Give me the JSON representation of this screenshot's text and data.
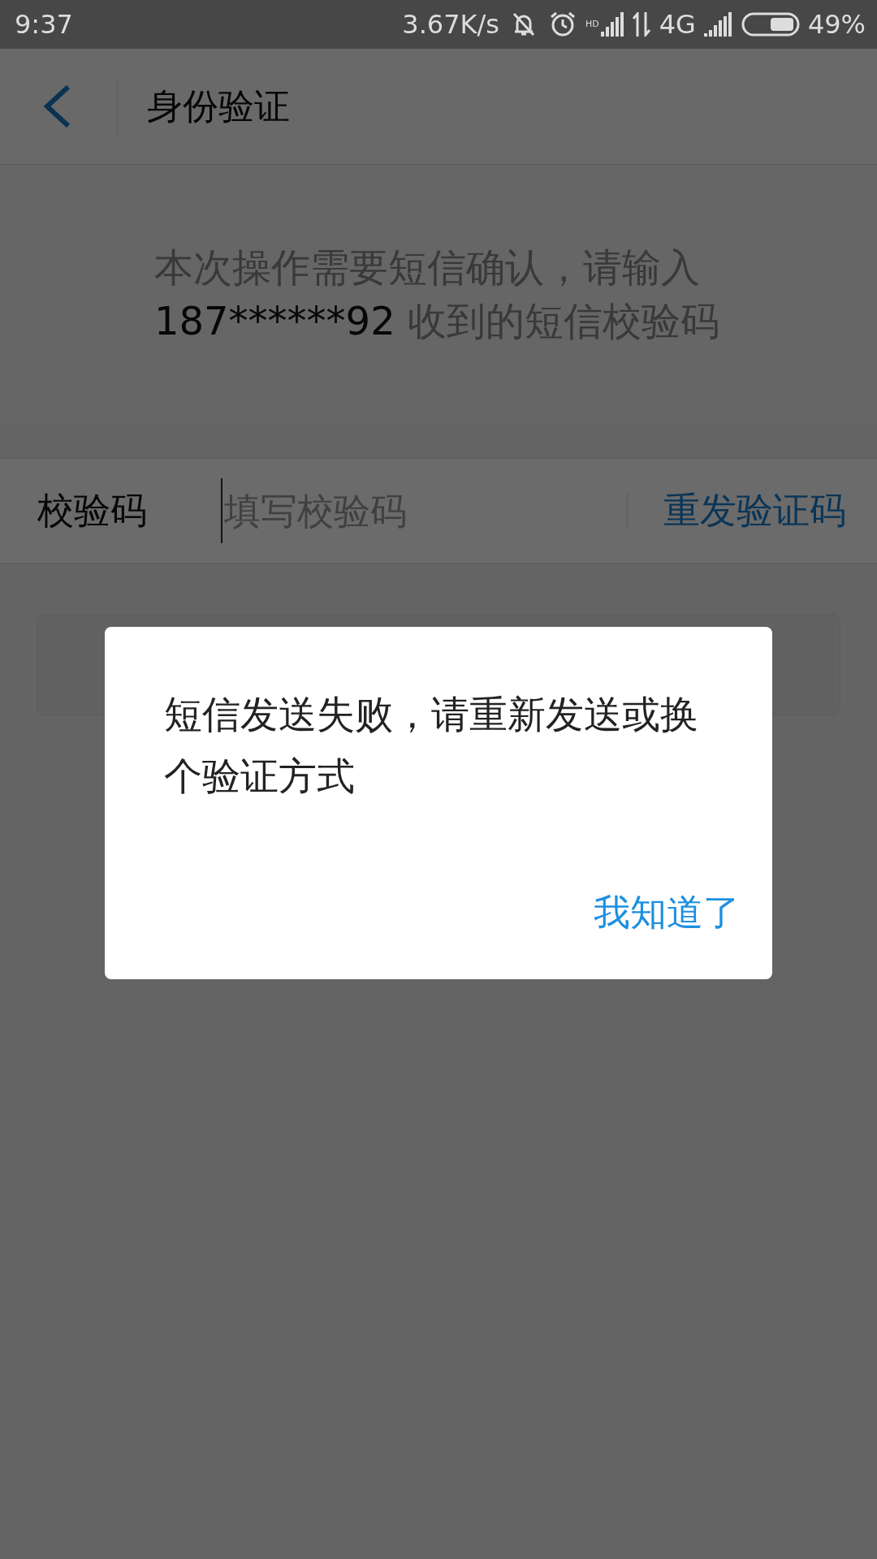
{
  "status_bar": {
    "time": "9:37",
    "net_speed": "3.67K/s",
    "hd": "HD",
    "network": "4G",
    "battery": "49%"
  },
  "header": {
    "title": "身份验证"
  },
  "prompt": {
    "before": "本次操作需要短信确认，请输入",
    "phone": "187******92",
    "after": " 收到的短信校验码"
  },
  "code_field": {
    "label": "校验码",
    "placeholder": "填写校验码",
    "resend": "重发验证码"
  },
  "dialog": {
    "message": "短信发送失败，请重新发送或换个验证方式",
    "button": "我知道了"
  }
}
